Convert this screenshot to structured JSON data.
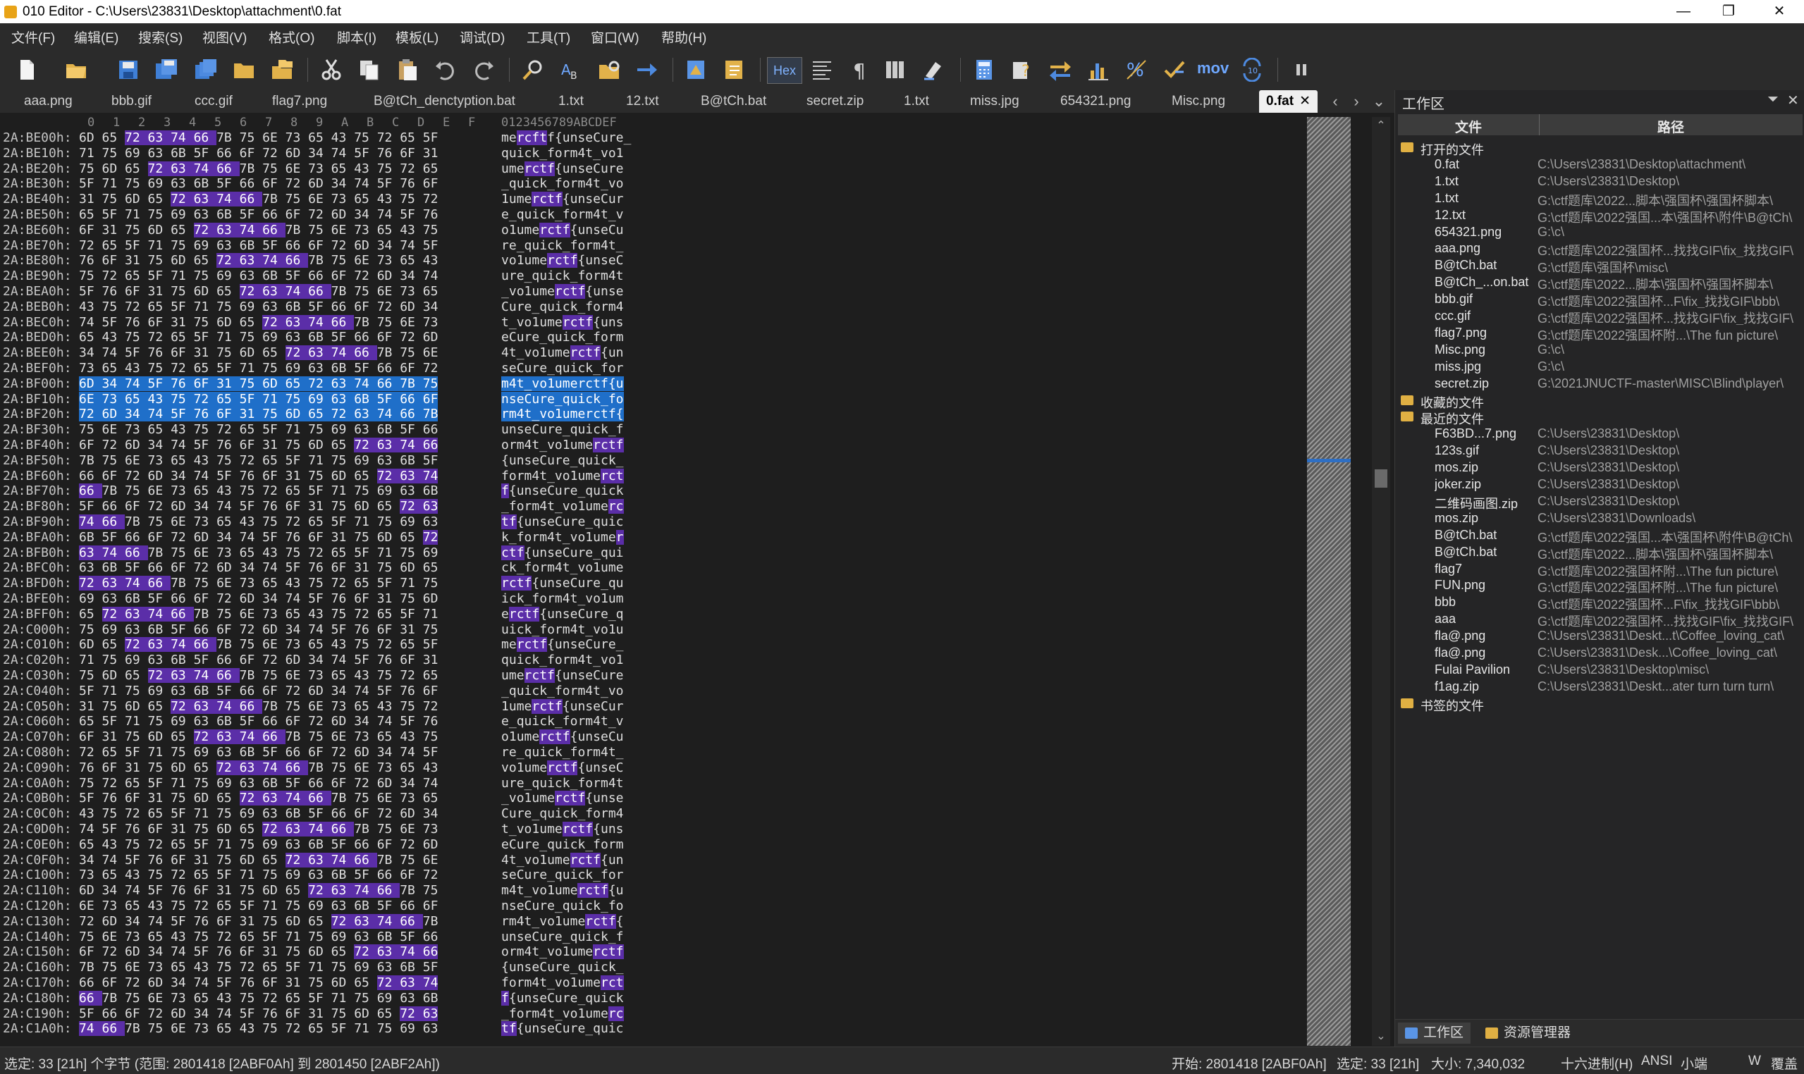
{
  "window": {
    "title": "010 Editor - C:\\Users\\23831\\Desktop\\attachment\\0.fat",
    "min": "—",
    "max": "❐",
    "close": "✕"
  },
  "menu": [
    "文件(F)",
    "编辑(E)",
    "搜索(S)",
    "视图(V)",
    "格式(O)",
    "脚本(I)",
    "模板(L)",
    "调试(D)",
    "工具(T)",
    "窗口(W)",
    "帮助(H)"
  ],
  "toolbar": {
    "hex_label": "Hex",
    "mov_label": "mov"
  },
  "tabs": [
    "aaa.png",
    "bbb.gif",
    "ccc.gif",
    "flag7.png",
    "B@tCh_denctyption.bat",
    "1.txt",
    "12.txt",
    "B@tCh.bat",
    "secret.zip",
    "1.txt",
    "miss.jpg",
    "654321.png",
    "Misc.png",
    "0.fat"
  ],
  "active_tab_close": "✕",
  "hex": {
    "col_headers": [
      "0",
      "1",
      "2",
      "3",
      "4",
      "5",
      "6",
      "7",
      "8",
      "9",
      "A",
      "B",
      "C",
      "D",
      "E",
      "F"
    ],
    "ascii_header": "0123456789ABCDEF",
    "rows": [
      [
        "2A:BE00h:",
        "6D 65 72 63 74 66 7B 75 6E 73 65 43 75 72 65 5F",
        "mercftf{unseCure_",
        [
          2,
          5
        ]
      ],
      [
        "2A:BE10h:",
        "71 75 69 63 6B 5F 66 6F 72 6D 34 74 5F 76 6F 31",
        "quick_form4t_vo1",
        null
      ],
      [
        "2A:BE20h:",
        "75 6D 65 72 63 74 66 7B 75 6E 73 65 43 75 72 65",
        "umerctf{unseCure",
        [
          3,
          6
        ]
      ],
      [
        "2A:BE30h:",
        "5F 71 75 69 63 6B 5F 66 6F 72 6D 34 74 5F 76 6F",
        "_quick_form4t_vo",
        null
      ],
      [
        "2A:BE40h:",
        "31 75 6D 65 72 63 74 66 7B 75 6E 73 65 43 75 72",
        "1umerctf{unseCur",
        [
          4,
          7
        ]
      ],
      [
        "2A:BE50h:",
        "65 5F 71 75 69 63 6B 5F 66 6F 72 6D 34 74 5F 76",
        "e_quick_form4t_v",
        null
      ],
      [
        "2A:BE60h:",
        "6F 31 75 6D 65 72 63 74 66 7B 75 6E 73 65 43 75",
        "o1umerctf{unseCu",
        [
          5,
          8
        ]
      ],
      [
        "2A:BE70h:",
        "72 65 5F 71 75 69 63 6B 5F 66 6F 72 6D 34 74 5F",
        "re_quick_form4t_",
        null
      ],
      [
        "2A:BE80h:",
        "76 6F 31 75 6D 65 72 63 74 66 7B 75 6E 73 65 43",
        "vo1umerctf{unseC",
        [
          6,
          9
        ]
      ],
      [
        "2A:BE90h:",
        "75 72 65 5F 71 75 69 63 6B 5F 66 6F 72 6D 34 74",
        "ure_quick_form4t",
        null
      ],
      [
        "2A:BEA0h:",
        "5F 76 6F 31 75 6D 65 72 63 74 66 7B 75 6E 73 65",
        "_vo1umerctf{unse",
        [
          7,
          10
        ]
      ],
      [
        "2A:BEB0h:",
        "43 75 72 65 5F 71 75 69 63 6B 5F 66 6F 72 6D 34",
        "Cure_quick_form4",
        null
      ],
      [
        "2A:BEC0h:",
        "74 5F 76 6F 31 75 6D 65 72 63 74 66 7B 75 6E 73",
        "t_vo1umerctf{uns",
        [
          8,
          11
        ]
      ],
      [
        "2A:BED0h:",
        "65 43 75 72 65 5F 71 75 69 63 6B 5F 66 6F 72 6D",
        "eCure_quick_form",
        null
      ],
      [
        "2A:BEE0h:",
        "34 74 5F 76 6F 31 75 6D 65 72 63 74 66 7B 75 6E",
        "4t_vo1umerctf{un",
        [
          9,
          12
        ]
      ],
      [
        "2A:BEF0h:",
        "73 65 43 75 72 65 5F 71 75 69 63 6B 5F 66 6F 72",
        "seCure_quick_for",
        null
      ],
      [
        "2A:BF00h:",
        "6D 34 74 5F 76 6F 31 75 6D 65 72 63 74 66 7B 75",
        "m4t_vo1umerctf{u",
        [
          10,
          13
        ]
      ],
      [
        "2A:BF10h:",
        "6E 73 65 43 75 72 65 5F 71 75 69 63 6B 5F 66 6F",
        "nseCure_quick_fo",
        null
      ],
      [
        "2A:BF20h:",
        "72 6D 34 74 5F 76 6F 31 75 6D 65 72 63 74 66 7B",
        "rm4t_vo1umerctf{",
        [
          11,
          14
        ]
      ],
      [
        "2A:BF30h:",
        "75 6E 73 65 43 75 72 65 5F 71 75 69 63 6B 5F 66",
        "unseCure_quick_f",
        null
      ],
      [
        "2A:BF40h:",
        "6F 72 6D 34 74 5F 76 6F 31 75 6D 65 72 63 74 66",
        "orm4t_vo1umerctf",
        [
          12,
          15
        ]
      ],
      [
        "2A:BF50h:",
        "7B 75 6E 73 65 43 75 72 65 5F 71 75 69 63 6B 5F",
        "{unseCure_quick_",
        null
      ],
      [
        "2A:BF60h:",
        "66 6F 72 6D 34 74 5F 76 6F 31 75 6D 65 72 63 74",
        "form4t_vo1umerct",
        [
          13,
          15
        ]
      ],
      [
        "2A:BF70h:",
        "66 7B 75 6E 73 65 43 75 72 65 5F 71 75 69 63 6B",
        "f{unseCure_quick",
        [
          0,
          0
        ]
      ],
      [
        "2A:BF80h:",
        "5F 66 6F 72 6D 34 74 5F 76 6F 31 75 6D 65 72 63",
        "_form4t_vo1umerc",
        [
          14,
          15
        ]
      ],
      [
        "2A:BF90h:",
        "74 66 7B 75 6E 73 65 43 75 72 65 5F 71 75 69 63",
        "tf{unseCure_quic",
        [
          0,
          1
        ]
      ],
      [
        "2A:BFA0h:",
        "6B 5F 66 6F 72 6D 34 74 5F 76 6F 31 75 6D 65 72",
        "k_form4t_vo1umer",
        [
          15,
          15
        ]
      ],
      [
        "2A:BFB0h:",
        "63 74 66 7B 75 6E 73 65 43 75 72 65 5F 71 75 69",
        "ctf{unseCure_qui",
        [
          0,
          2
        ]
      ],
      [
        "2A:BFC0h:",
        "63 6B 5F 66 6F 72 6D 34 74 5F 76 6F 31 75 6D 65",
        "ck_form4t_vo1ume",
        null
      ],
      [
        "2A:BFD0h:",
        "72 63 74 66 7B 75 6E 73 65 43 75 72 65 5F 71 75",
        "rctf{unseCure_qu",
        [
          0,
          3
        ]
      ],
      [
        "2A:BFE0h:",
        "69 63 6B 5F 66 6F 72 6D 34 74 5F 76 6F 31 75 6D",
        "ick_form4t_vo1um",
        null
      ],
      [
        "2A:BFF0h:",
        "65 72 63 74 66 7B 75 6E 73 65 43 75 72 65 5F 71",
        "erctf{unseCure_q",
        [
          1,
          4
        ]
      ],
      [
        "2A:C000h:",
        "75 69 63 6B 5F 66 6F 72 6D 34 74 5F 76 6F 31 75",
        "uick_form4t_vo1u",
        null
      ],
      [
        "2A:C010h:",
        "6D 65 72 63 74 66 7B 75 6E 73 65 43 75 72 65 5F",
        "merctf{unseCure_",
        [
          2,
          5
        ]
      ],
      [
        "2A:C020h:",
        "71 75 69 63 6B 5F 66 6F 72 6D 34 74 5F 76 6F 31",
        "quick_form4t_vo1",
        null
      ],
      [
        "2A:C030h:",
        "75 6D 65 72 63 74 66 7B 75 6E 73 65 43 75 72 65",
        "umerctf{unseCure",
        [
          3,
          6
        ]
      ],
      [
        "2A:C040h:",
        "5F 71 75 69 63 6B 5F 66 6F 72 6D 34 74 5F 76 6F",
        "_quick_form4t_vo",
        null
      ],
      [
        "2A:C050h:",
        "31 75 6D 65 72 63 74 66 7B 75 6E 73 65 43 75 72",
        "1umerctf{unseCur",
        [
          4,
          7
        ]
      ],
      [
        "2A:C060h:",
        "65 5F 71 75 69 63 6B 5F 66 6F 72 6D 34 74 5F 76",
        "e_quick_form4t_v",
        null
      ],
      [
        "2A:C070h:",
        "6F 31 75 6D 65 72 63 74 66 7B 75 6E 73 65 43 75",
        "o1umerctf{unseCu",
        [
          5,
          8
        ]
      ],
      [
        "2A:C080h:",
        "72 65 5F 71 75 69 63 6B 5F 66 6F 72 6D 34 74 5F",
        "re_quick_form4t_",
        null
      ],
      [
        "2A:C090h:",
        "76 6F 31 75 6D 65 72 63 74 66 7B 75 6E 73 65 43",
        "vo1umerctf{unseC",
        [
          6,
          9
        ]
      ],
      [
        "2A:C0A0h:",
        "75 72 65 5F 71 75 69 63 6B 5F 66 6F 72 6D 34 74",
        "ure_quick_form4t",
        null
      ],
      [
        "2A:C0B0h:",
        "5F 76 6F 31 75 6D 65 72 63 74 66 7B 75 6E 73 65",
        "_vo1umerctf{unse",
        [
          7,
          10
        ]
      ],
      [
        "2A:C0C0h:",
        "43 75 72 65 5F 71 75 69 63 6B 5F 66 6F 72 6D 34",
        "Cure_quick_form4",
        null
      ],
      [
        "2A:C0D0h:",
        "74 5F 76 6F 31 75 6D 65 72 63 74 66 7B 75 6E 73",
        "t_vo1umerctf{uns",
        [
          8,
          11
        ]
      ],
      [
        "2A:C0E0h:",
        "65 43 75 72 65 5F 71 75 69 63 6B 5F 66 6F 72 6D",
        "eCure_quick_form",
        null
      ],
      [
        "2A:C0F0h:",
        "34 74 5F 76 6F 31 75 6D 65 72 63 74 66 7B 75 6E",
        "4t_vo1umerctf{un",
        [
          9,
          12
        ]
      ],
      [
        "2A:C100h:",
        "73 65 43 75 72 65 5F 71 75 69 63 6B 5F 66 6F 72",
        "seCure_quick_for",
        null
      ],
      [
        "2A:C110h:",
        "6D 34 74 5F 76 6F 31 75 6D 65 72 63 74 66 7B 75",
        "m4t_vo1umerctf{u",
        [
          10,
          13
        ]
      ],
      [
        "2A:C120h:",
        "6E 73 65 43 75 72 65 5F 71 75 69 63 6B 5F 66 6F",
        "nseCure_quick_fo",
        null
      ],
      [
        "2A:C130h:",
        "72 6D 34 74 5F 76 6F 31 75 6D 65 72 63 74 66 7B",
        "rm4t_vo1umerctf{",
        [
          11,
          14
        ]
      ],
      [
        "2A:C140h:",
        "75 6E 73 65 43 75 72 65 5F 71 75 69 63 6B 5F 66",
        "unseCure_quick_f",
        null
      ],
      [
        "2A:C150h:",
        "6F 72 6D 34 74 5F 76 6F 31 75 6D 65 72 63 74 66",
        "orm4t_vo1umerctf",
        [
          12,
          15
        ]
      ],
      [
        "2A:C160h:",
        "7B 75 6E 73 65 43 75 72 65 5F 71 75 69 63 6B 5F",
        "{unseCure_quick_",
        null
      ],
      [
        "2A:C170h:",
        "66 6F 72 6D 34 74 5F 76 6F 31 75 6D 65 72 63 74",
        "form4t_vo1umerct",
        [
          13,
          15
        ]
      ],
      [
        "2A:C180h:",
        "66 7B 75 6E 73 65 43 75 72 65 5F 71 75 69 63 6B",
        "f{unseCure_quick",
        [
          0,
          0
        ]
      ],
      [
        "2A:C190h:",
        "5F 66 6F 72 6D 34 74 5F 76 6F 31 75 6D 65 72 63",
        "_form4t_vo1umerc",
        [
          14,
          15
        ]
      ],
      [
        "2A:C1A0h:",
        "74 66 7B 75 6E 73 65 43 75 72 65 5F 71 75 69 63",
        "tf{unseCure_quic",
        [
          0,
          1
        ]
      ]
    ],
    "selected_rows": [
      16,
      17,
      18
    ]
  },
  "workspace": {
    "title": "工作区",
    "col_file": "文件",
    "col_path": "路径",
    "tree": [
      {
        "group": "打开的文件"
      },
      {
        "name": "0.fat",
        "path": "C:\\Users\\23831\\Desktop\\attachment\\"
      },
      {
        "name": "1.txt",
        "path": "C:\\Users\\23831\\Desktop\\"
      },
      {
        "name": "1.txt",
        "path": "G:\\ctf题库\\2022...脚本\\强国杯\\强国杯脚本\\"
      },
      {
        "name": "12.txt",
        "path": "G:\\ctf题库\\2022强国...本\\强国杯\\附件\\B@tCh\\"
      },
      {
        "name": "654321.png",
        "path": "G:\\c\\"
      },
      {
        "name": "aaa.png",
        "path": "G:\\ctf题库\\2022强国杯...找找GIF\\fix_找找GIF\\"
      },
      {
        "name": "B@tCh.bat",
        "path": "G:\\ctf题库\\强国杯\\misc\\"
      },
      {
        "name": "B@tCh_...on.bat",
        "path": "G:\\ctf题库\\2022...脚本\\强国杯\\强国杯脚本\\"
      },
      {
        "name": "bbb.gif",
        "path": "G:\\ctf题库\\2022强国杯...F\\fix_找找GIF\\bbb\\"
      },
      {
        "name": "ccc.gif",
        "path": "G:\\ctf题库\\2022强国杯...找找GIF\\fix_找找GIF\\"
      },
      {
        "name": "flag7.png",
        "path": "G:\\ctf题库\\2022强国杯附...\\The fun picture\\"
      },
      {
        "name": "Misc.png",
        "path": "G:\\c\\"
      },
      {
        "name": "miss.jpg",
        "path": "G:\\c\\"
      },
      {
        "name": "secret.zip",
        "path": "G:\\2021JNUCTF-master\\MISC\\Blind\\player\\"
      },
      {
        "group": "收藏的文件"
      },
      {
        "group": "最近的文件"
      },
      {
        "name": "F63BD...7.png",
        "path": "C:\\Users\\23831\\Desktop\\"
      },
      {
        "name": "123s.gif",
        "path": "C:\\Users\\23831\\Desktop\\"
      },
      {
        "name": "mos.zip",
        "path": "C:\\Users\\23831\\Desktop\\"
      },
      {
        "name": "joker.zip",
        "path": "C:\\Users\\23831\\Desktop\\"
      },
      {
        "name": "二维码画图.zip",
        "path": "C:\\Users\\23831\\Desktop\\"
      },
      {
        "name": "mos.zip",
        "path": "C:\\Users\\23831\\Downloads\\"
      },
      {
        "name": "B@tCh.bat",
        "path": "G:\\ctf题库\\2022强国...本\\强国杯\\附件\\B@tCh\\"
      },
      {
        "name": "B@tCh.bat",
        "path": "G:\\ctf题库\\2022...脚本\\强国杯\\强国杯脚本\\"
      },
      {
        "name": "flag7",
        "path": "G:\\ctf题库\\2022强国杯附...\\The fun picture\\"
      },
      {
        "name": "FUN.png",
        "path": "G:\\ctf题库\\2022强国杯附...\\The fun picture\\"
      },
      {
        "name": "bbb",
        "path": "G:\\ctf题库\\2022强国杯...F\\fix_找找GIF\\bbb\\"
      },
      {
        "name": "aaa",
        "path": "G:\\ctf题库\\2022强国杯...找找GIF\\fix_找找GIF\\"
      },
      {
        "name": "fla@.png",
        "path": "C:\\Users\\23831\\Deskt...t\\Coffee_loving_cat\\"
      },
      {
        "name": "fla@.png",
        "path": "C:\\Users\\23831\\Desk...\\Coffee_loving_cat\\"
      },
      {
        "name": "Fulai Pavilion",
        "path": "C:\\Users\\23831\\Desktop\\misc\\"
      },
      {
        "name": "f1ag.zip",
        "path": "C:\\Users\\23831\\Deskt...ater turn turn turn\\"
      },
      {
        "group": "书签的文件"
      }
    ],
    "bottom_tabs": [
      "工作区",
      "资源管理器"
    ]
  },
  "status": {
    "left": "选定: 33 [21h] 个字节 (范围: 2801418 [2ABF0Ah] 到 2801450 [2ABF2Ah])",
    "start": "开始: 2801418 [2ABF0Ah]",
    "selected": "选定: 33 [21h]",
    "size": "大小: 7,340,032",
    "mode": "十六进制(H)",
    "encoding": "ANSI",
    "endian": "小端",
    "w": "W",
    "overwrite": "覆盖"
  }
}
